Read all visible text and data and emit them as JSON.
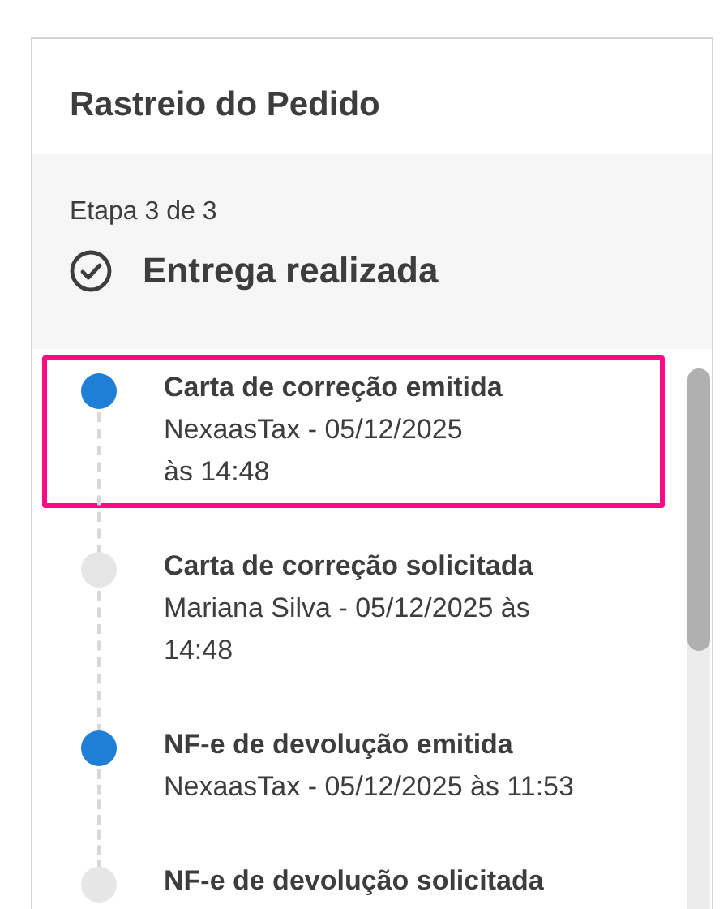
{
  "panel": {
    "title": "Rastreio do Pedido"
  },
  "status": {
    "step": "Etapa 3 de 3",
    "label": "Entrega realizada"
  },
  "timeline": [
    {
      "title": "Carta de correção emitida",
      "meta": "NexaasTax  - 05/12/2025\nàs 14:48",
      "color": "#1f7fd6",
      "selected": true
    },
    {
      "title": "Carta de correção solicitada",
      "meta": "Mariana Silva - 05/12/2025 às\n14:48",
      "color": "#e6e6e6",
      "selected": false
    },
    {
      "title": "NF-e de devolução emitida",
      "meta": "NexaasTax - 05/12/2025 às 11:53",
      "color": "#1f7fd6",
      "selected": false
    },
    {
      "title": "NF-e de devolução solicitada",
      "color": "#e6e6e6",
      "selected": false
    }
  ]
}
